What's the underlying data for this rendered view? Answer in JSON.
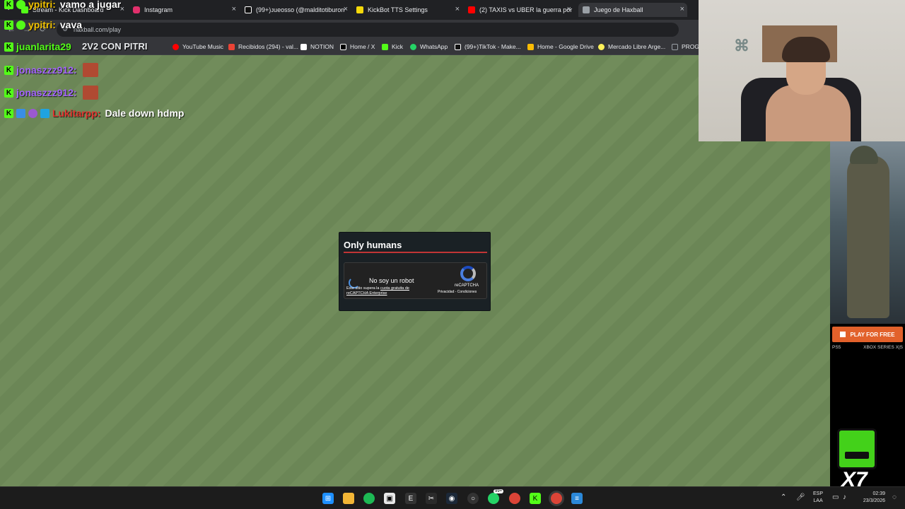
{
  "browser": {
    "tabs": [
      {
        "label": "Stream - Kick Dashboard",
        "color": "#53fc18"
      },
      {
        "label": "Instagram",
        "color": "#e1306c"
      },
      {
        "label": "(99+)ᴊueosso (@malditotiburon",
        "color": "#ffffff"
      },
      {
        "label": "KickBot TTS Settings",
        "color": "#f5d90a"
      },
      {
        "label": "(2) TAXIS vs UBER la guerra por",
        "color": "#ff0000"
      },
      {
        "label": "Juego de Haxball",
        "color": "#9aa0a6"
      }
    ],
    "url": "haxball.com/play",
    "bookmarks": [
      {
        "label": "2V2 CON PITRI",
        "color": "#e8eaed"
      },
      {
        "label": "YouTube Music",
        "color": "#ff0000"
      },
      {
        "label": "Recibidos (294) - val...",
        "color": "#ea4335"
      },
      {
        "label": "NOTION",
        "color": "#ffffff"
      },
      {
        "label": "Home / X",
        "color": "#ffffff"
      },
      {
        "label": "Kick",
        "color": "#53fc18"
      },
      {
        "label": "WhatsApp",
        "color": "#25d366"
      },
      {
        "label": "(99+)TikTok - Make...",
        "color": "#ffffff"
      },
      {
        "label": "Home - Google Drive",
        "color": "#fbbc04"
      },
      {
        "label": "Mercado Libre Arge...",
        "color": "#fff159"
      },
      {
        "label": "PROG",
        "color": "#9aa0a6"
      }
    ]
  },
  "dialog": {
    "title": "Only humans",
    "checkbox_label": "No soy un robot",
    "notice_prefix": "Este sitio supera la ",
    "notice_link": "cuota gratuita de reCAPTCHA Enterprise",
    "brand": "reCAPTCHA",
    "terms": "Privacidad - Condiciones"
  },
  "chat": [
    {
      "user": "ypitri:",
      "text": "vamo a jugar",
      "user_color": "#f2c300"
    },
    {
      "user": "ypitri:",
      "text": "vava",
      "user_color": "#f2c300"
    },
    {
      "user": "juanlarita29",
      "text": "",
      "user_color": "#53fc18"
    },
    {
      "user": "jonaszzz912:",
      "text": "",
      "user_color": "#a463ff"
    },
    {
      "user": "jonaszzz912:",
      "text": "",
      "user_color": "#a463ff"
    },
    {
      "user": "Lukitarpp:",
      "text": "Dale down hdmp",
      "user_color": "#e0342f"
    }
  ],
  "kick_badge_glyph": "K",
  "ad": {
    "cta": "PLAY FOR FREE",
    "platform_left": "PS5",
    "platform_right": "XBOX SERIES X|S",
    "mascot_label": "X7"
  },
  "taskbar": {
    "language_line1": "ESP",
    "language_line2": "LAA",
    "time": "02:39",
    "date": "23/3/2026",
    "whatsapp_badge": "99+"
  }
}
